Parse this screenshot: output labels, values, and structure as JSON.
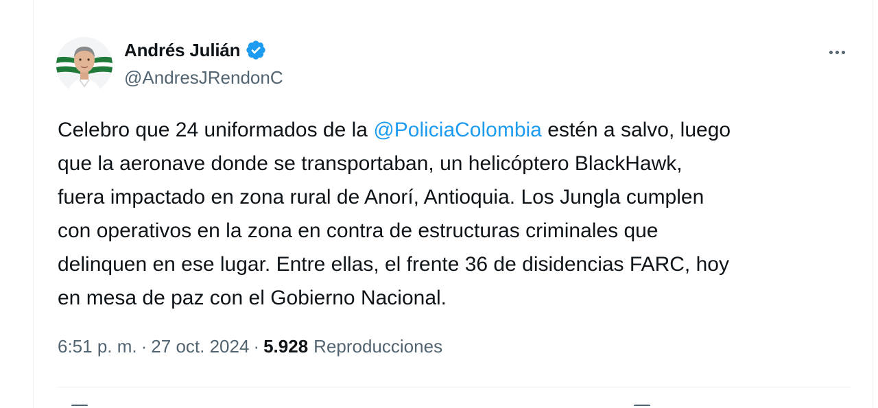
{
  "author": {
    "name": "Andrés Julián",
    "handle": "@AndresJRendonC",
    "verified": true,
    "avatar": "profile-photo"
  },
  "menu": {
    "more_icon": "more-horizontal-icon"
  },
  "tweet": {
    "lines": [
      {
        "before": "Celebro que 24 uniformados de la ",
        "mention": "@PoliciaColombia",
        "after": " estén a salvo, luego"
      },
      {
        "text": "que la aeronave donde se transportaban, un helicóptero BlackHawk,"
      },
      {
        "text": "fuera impactado en zona rural de Anorí, Antioquia. Los Jungla cumplen"
      },
      {
        "text": "con operativos en la zona en contra de estructuras criminales que"
      },
      {
        "text": "delinquen en ese lugar. Entre ellas, el frente 36 de disidencias FARC, hoy"
      },
      {
        "text": "en mesa de paz con el Gobierno Nacional."
      }
    ]
  },
  "meta": {
    "time": "6:51 p. m.",
    "date": "27 oct. 2024",
    "separator": "·",
    "views_count": "5.928",
    "views_label": "Reproducciones"
  },
  "colors": {
    "accent": "#1d9bf0",
    "text": "#0f1419",
    "secondary": "#536471"
  }
}
